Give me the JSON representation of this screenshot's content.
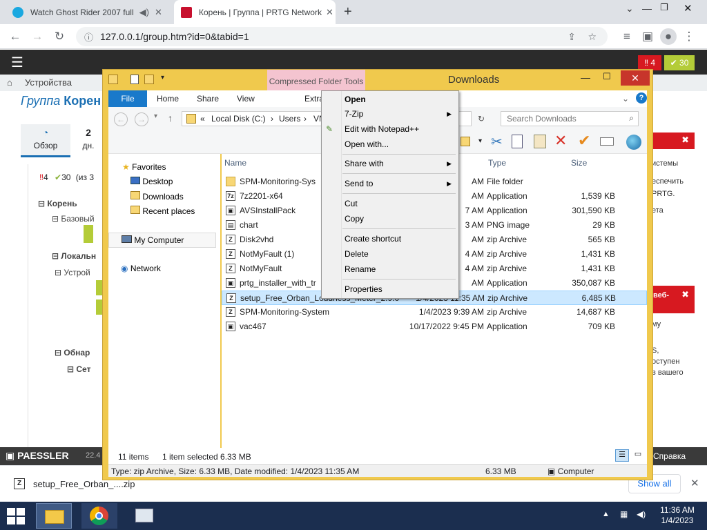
{
  "browser": {
    "tabs": [
      {
        "title": "Watch Ghost Rider 2007 full",
        "fav_color": "#1aa8e0"
      },
      {
        "title": "Корень | Группа | PRTG Network",
        "fav_color": "#c8102e"
      }
    ],
    "url": "127.0.0.1/group.htm?id=0&tabid=1"
  },
  "prtg": {
    "alarm_count": "4",
    "ok_count": "30",
    "breadcrumb": "Устройства",
    "page_title_prefix": "Группа",
    "page_title_name": "Корен",
    "tab_overview": "Обзор",
    "tab_days_num": "2",
    "tab_days_label": "дн.",
    "status_alarm": "4",
    "status_ok": "30",
    "status_of": "(из 3",
    "tree": [
      "Корень",
      "Базовый",
      "Локальн",
      "Устрой",
      "Обнар",
      "Сет"
    ],
    "right_text_1": [
      "истемы",
      "еспечить",
      "PRTG.",
      "ета"
    ],
    "right_text_2": [
      "веб-",
      "му",
      "S,",
      "оступен",
      "в вашего"
    ],
    "footer_brand": "PAESSLER",
    "footer_time": "22.4",
    "footer_help": "Справка"
  },
  "explorer": {
    "context_tab": "Compressed Folder Tools",
    "title": "Downloads",
    "ribbon": [
      "File",
      "Home",
      "Share",
      "View",
      "Extra"
    ],
    "address": [
      "Local Disk (C:)",
      "Users",
      "VN"
    ],
    "search_placeholder": "Search Downloads",
    "nav": {
      "favorites": "Favorites",
      "desktop": "Desktop",
      "downloads": "Downloads",
      "recent": "Recent places",
      "computer": "My Computer",
      "network": "Network"
    },
    "columns": {
      "name": "Name",
      "date": "d",
      "type": "Type",
      "size": "Size"
    },
    "files": [
      {
        "name": "SPM-Monitoring-Sys",
        "date": "AM",
        "type": "File folder",
        "size": "",
        "icon": "folder"
      },
      {
        "name": "7z2201-x64",
        "date": "AM",
        "type": "Application",
        "size": "1,539 KB",
        "icon": "7z"
      },
      {
        "name": "AVSInstallPack",
        "date": "7 AM",
        "type": "Application",
        "size": "301,590 KB",
        "icon": "app"
      },
      {
        "name": "chart",
        "date": "3 AM",
        "type": "PNG image",
        "size": "29 KB",
        "icon": "img"
      },
      {
        "name": "Disk2vhd",
        "date": "AM",
        "type": "zip Archive",
        "size": "565 KB",
        "icon": "zip"
      },
      {
        "name": "NotMyFault (1)",
        "date": "4 AM",
        "type": "zip Archive",
        "size": "1,431 KB",
        "icon": "zip"
      },
      {
        "name": "NotMyFault",
        "date": "4 AM",
        "type": "zip Archive",
        "size": "1,431 KB",
        "icon": "zip"
      },
      {
        "name": "prtg_installer_with_tr",
        "date": "AM",
        "type": "Application",
        "size": "350,087 KB",
        "icon": "app"
      },
      {
        "name": "setup_Free_Orban_Loudness_Meter_2.9.0",
        "date": "1/4/2023 11:35 AM",
        "type": "zip Archive",
        "size": "6,485 KB",
        "icon": "zip",
        "selected": true
      },
      {
        "name": "SPM-Monitoring-System_v3.9.0.6",
        "date": "1/4/2023 9:39 AM",
        "type": "zip Archive",
        "size": "14,687 KB",
        "icon": "zip"
      },
      {
        "name": "vac467",
        "date": "10/17/2022 9:45 PM",
        "type": "Application",
        "size": "709 KB",
        "icon": "app"
      }
    ],
    "status_items": "11 items",
    "status_selected": "1 item selected  6.33 MB",
    "details_info": "Type: zip Archive, Size: 6.33 MB, Date modified: 1/4/2023 11:35 AM",
    "details_size": "6.33 MB",
    "details_location": "Computer"
  },
  "context_menu": {
    "open": "Open",
    "zip7": "7-Zip",
    "notepad": "Edit with Notepad++",
    "open_with": "Open with...",
    "share_with": "Share with",
    "send_to": "Send to",
    "cut": "Cut",
    "copy": "Copy",
    "create_shortcut": "Create shortcut",
    "delete": "Delete",
    "rename": "Rename",
    "properties": "Properties"
  },
  "download_bar": {
    "file": "setup_Free_Orban_....zip",
    "show_all": "Show all"
  },
  "taskbar": {
    "time": "11:36 AM",
    "date": "1/4/2023"
  }
}
